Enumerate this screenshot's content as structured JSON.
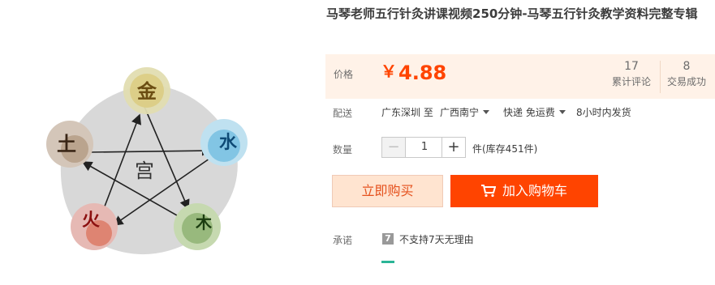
{
  "product": {
    "title": "马琴老师五行针灸讲课视频250分钟-马琴五行针灸教学资料完整专辑"
  },
  "price": {
    "label": "价格",
    "currency": "￥",
    "value": "4.88"
  },
  "stats": {
    "reviews_count": "17",
    "reviews_label": "累计评论",
    "sales_count": "8",
    "sales_label": "交易成功"
  },
  "shipping": {
    "label": "配送",
    "from": "广东深圳 至",
    "to": "广西南宁",
    "method": "快递 免运费",
    "dispatch": "8小时内发货"
  },
  "quantity": {
    "label": "数量",
    "minus": "−",
    "value": "1",
    "plus": "+",
    "stock": "件(库存451件)"
  },
  "buttons": {
    "buy_now": "立即购买",
    "add_to_cart": "加入购物车"
  },
  "promise": {
    "label": "承诺",
    "icon_text": "7",
    "text": "不支持7天无理由"
  },
  "diagram": {
    "center": "宫",
    "nodes": {
      "metal": "金",
      "water": "水",
      "wood": "木",
      "fire": "火",
      "earth": "土"
    }
  },
  "colors": {
    "accent": "#ff4400",
    "price_bg": "#fff2e8",
    "buy_bg": "#ffe4d0",
    "promise_green": "#2bb596"
  }
}
